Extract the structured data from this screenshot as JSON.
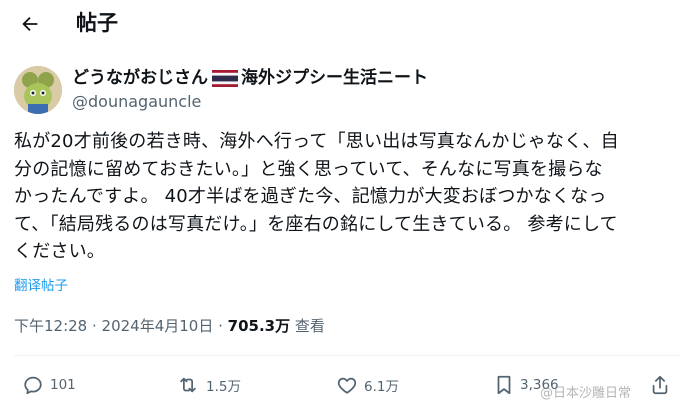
{
  "header": {
    "title": "帖子"
  },
  "author": {
    "display_name_before_flag": "どうながおじさん",
    "display_name_after_flag": "海外ジプシー生活ニート",
    "handle": "@dounagauncle"
  },
  "post": {
    "text": "私が20才前後の若き時、海外へ行って「思い出は写真なんかじゃなく、自\n分の記憶に留めておきたい。」と強く思っていて、そんなに写真を撮らな\nかったんですよ。 40才半ばを過ぎた今、記憶力が大変おぼつかなくなっ\nて、「結局残るのは写真だけ。」を座右の銘にして生きている。 参考にして\nください。",
    "translate_label": "翻译帖子"
  },
  "meta": {
    "time": "下午12:28 · 2024年4月10日 · ",
    "views": "705.3万",
    "views_label": " 查看"
  },
  "actions": {
    "replies": "101",
    "reposts": "1.5万",
    "likes": "6.1万",
    "bookmarks": "3,366"
  },
  "watermark": "@日本沙雕日常",
  "colors": {
    "accent": "#1d9bf0",
    "muted": "#536471",
    "text": "#0f1419",
    "divider": "#eff3f4"
  }
}
